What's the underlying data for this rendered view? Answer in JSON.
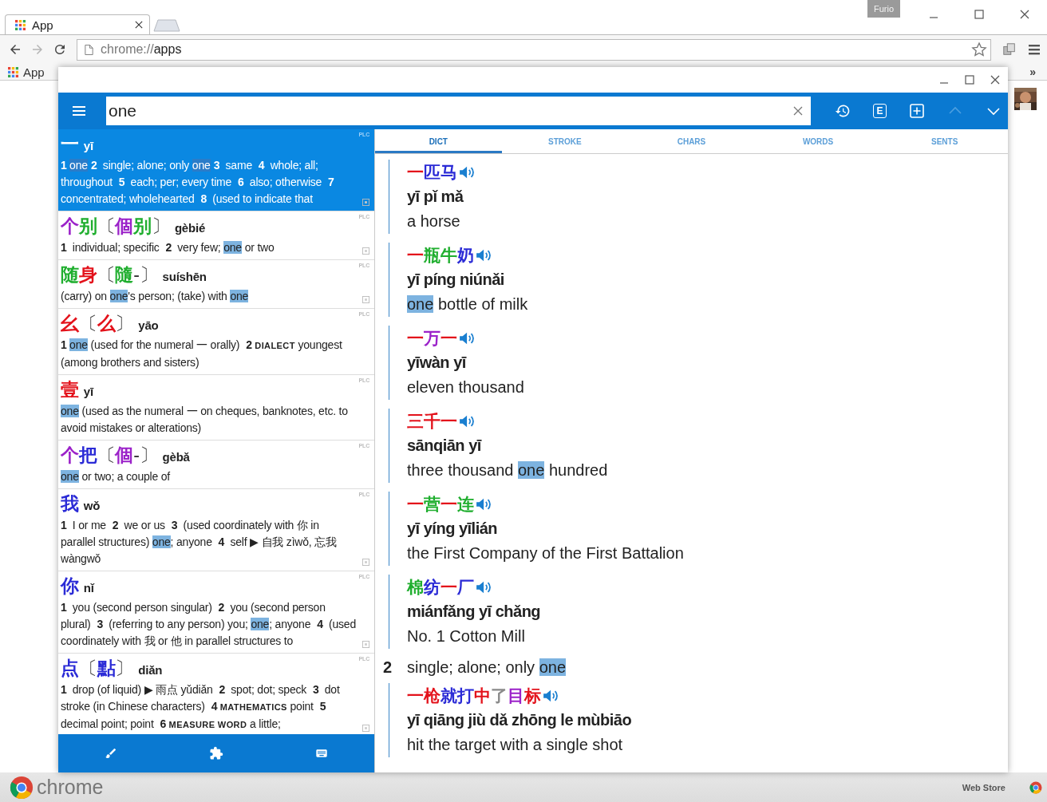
{
  "browser": {
    "tabs": [
      {
        "title": "App",
        "selected": true
      }
    ],
    "profile": "Furio",
    "nav": [
      {
        "kind": "back",
        "disabled": false
      },
      {
        "kind": "forward",
        "disabled": true
      },
      {
        "kind": "reload",
        "disabled": false
      }
    ],
    "address": {
      "scheme": "chrome://",
      "path": "apps"
    },
    "bookmarks": [
      {
        "label": "App"
      }
    ],
    "bookmarks_overflow": "»"
  },
  "app": {
    "search": {
      "value": "one"
    },
    "toolbar": [
      {
        "kind": "history",
        "disabled": false
      },
      {
        "kind": "letter",
        "label": "E",
        "disabled": false
      },
      {
        "kind": "add",
        "disabled": false
      },
      {
        "kind": "up",
        "disabled": true
      },
      {
        "kind": "down",
        "disabled": false
      }
    ],
    "results": [
      {
        "selected": true,
        "source": "PLC",
        "truncated": true,
        "headword": [
          {
            "text": "一",
            "color": "#ffffff"
          }
        ],
        "pinyin": "yī",
        "definition": [
          {
            "kind": "num",
            "text": "1"
          },
          {
            "kind": "hit",
            "text": "one"
          },
          {
            "kind": "num",
            "text": "2"
          },
          {
            "kind": "text",
            "text": " single; alone; only "
          },
          {
            "kind": "hit",
            "text": "one"
          },
          {
            "kind": "num",
            "text": "3"
          },
          {
            "kind": "text",
            "text": " same  "
          },
          {
            "kind": "num",
            "text": "4"
          },
          {
            "kind": "text",
            "text": " whole; all; throughout  "
          },
          {
            "kind": "num",
            "text": "5"
          },
          {
            "kind": "text",
            "text": " each; per; every time  "
          },
          {
            "kind": "num",
            "text": "6"
          },
          {
            "kind": "text",
            "text": " also; otherwise  "
          },
          {
            "kind": "num",
            "text": "7"
          },
          {
            "kind": "text",
            "text": " concentrated; wholehearted  "
          },
          {
            "kind": "num",
            "text": "8"
          },
          {
            "kind": "text",
            "text": " (used to indicate that"
          }
        ]
      },
      {
        "selected": false,
        "source": "PLC",
        "truncated": true,
        "headword": [
          {
            "text": "个",
            "color": "#9b22c9"
          },
          {
            "text": "别",
            "color": "#1fae2e"
          },
          {
            "kind": "bracket",
            "text": "〔"
          },
          {
            "text": "個",
            "color": "#9b22c9"
          },
          {
            "text": "别",
            "color": "#1fae2e"
          },
          {
            "kind": "bracket",
            "text": "〕"
          }
        ],
        "pinyin": "gèbié",
        "definition": [
          {
            "kind": "num",
            "text": "1"
          },
          {
            "kind": "text",
            "text": " individual; specific  "
          },
          {
            "kind": "num",
            "text": "2"
          },
          {
            "kind": "text",
            "text": " very few; "
          },
          {
            "kind": "hit",
            "text": "one"
          },
          {
            "kind": "text",
            "text": " or two"
          }
        ]
      },
      {
        "selected": false,
        "source": "PLC",
        "truncated": true,
        "headword": [
          {
            "text": "随",
            "color": "#1fae2e"
          },
          {
            "text": "身",
            "color": "#e3121b"
          },
          {
            "kind": "bracket",
            "text": "〔"
          },
          {
            "text": "隨",
            "color": "#1fae2e"
          },
          {
            "kind": "bracket",
            "text": "-"
          },
          {
            "kind": "bracket",
            "text": "〕"
          }
        ],
        "pinyin": "suíshēn",
        "definition": [
          {
            "kind": "text",
            "text": "(carry) on "
          },
          {
            "kind": "hit",
            "text": "one"
          },
          {
            "kind": "text",
            "text": "'s person; (take) with "
          },
          {
            "kind": "hit",
            "text": "one"
          }
        ]
      },
      {
        "selected": false,
        "source": "PLC",
        "truncated": false,
        "headword": [
          {
            "text": "幺",
            "color": "#e3121b"
          },
          {
            "kind": "bracket",
            "text": "〔"
          },
          {
            "text": "么",
            "color": "#e3121b"
          },
          {
            "kind": "bracket",
            "text": "〕"
          }
        ],
        "pinyin": "yāo",
        "definition": [
          {
            "kind": "num",
            "text": "1"
          },
          {
            "kind": "hit",
            "text": "one"
          },
          {
            "kind": "text",
            "text": " (used for the numeral 一 orally)  "
          },
          {
            "kind": "num",
            "text": "2"
          },
          {
            "kind": "label",
            "text": "DIALECT"
          },
          {
            "kind": "text",
            "text": " youngest (among brothers and sisters)"
          }
        ]
      },
      {
        "selected": false,
        "source": "PLC",
        "truncated": false,
        "headword": [
          {
            "text": "壹",
            "color": "#e3121b"
          }
        ],
        "pinyin": "yī",
        "definition": [
          {
            "kind": "hit",
            "text": "one"
          },
          {
            "kind": "text",
            "text": " (used as the numeral 一 on cheques, banknotes, etc. to avoid mistakes or alterations)"
          }
        ]
      },
      {
        "selected": false,
        "source": "PLC",
        "truncated": false,
        "headword": [
          {
            "text": "个",
            "color": "#9b22c9"
          },
          {
            "text": "把",
            "color": "#2b2bd6"
          },
          {
            "kind": "bracket",
            "text": "〔"
          },
          {
            "text": "個",
            "color": "#9b22c9"
          },
          {
            "kind": "bracket",
            "text": "-"
          },
          {
            "kind": "bracket",
            "text": "〕"
          }
        ],
        "pinyin": "gèbǎ",
        "definition": [
          {
            "kind": "hit",
            "text": "one"
          },
          {
            "kind": "text",
            "text": " or two; a couple of"
          }
        ]
      },
      {
        "selected": false,
        "source": "PLC",
        "truncated": true,
        "headword": [
          {
            "text": "我",
            "color": "#2b2bd6"
          }
        ],
        "pinyin": "wǒ",
        "definition": [
          {
            "kind": "num",
            "text": "1"
          },
          {
            "kind": "text",
            "text": " I or me  "
          },
          {
            "kind": "num",
            "text": "2"
          },
          {
            "kind": "text",
            "text": " we or us  "
          },
          {
            "kind": "num",
            "text": "3"
          },
          {
            "kind": "text",
            "text": " (used coordinately with 你 in parallel structures) "
          },
          {
            "kind": "hit",
            "text": "one"
          },
          {
            "kind": "text",
            "text": "; anyone  "
          },
          {
            "kind": "num",
            "text": "4"
          },
          {
            "kind": "text",
            "text": " self ▶ 自我 zìwǒ, 忘我 wàngwǒ"
          }
        ]
      },
      {
        "selected": false,
        "source": "PLC",
        "truncated": true,
        "headword": [
          {
            "text": "你",
            "color": "#2b2bd6"
          }
        ],
        "pinyin": "nǐ",
        "definition": [
          {
            "kind": "num",
            "text": "1"
          },
          {
            "kind": "text",
            "text": " you (second person singular)  "
          },
          {
            "kind": "num",
            "text": "2"
          },
          {
            "kind": "text",
            "text": " you (second person plural)  "
          },
          {
            "kind": "num",
            "text": "3"
          },
          {
            "kind": "text",
            "text": " (referring to any person) you; "
          },
          {
            "kind": "hit",
            "text": "one"
          },
          {
            "kind": "text",
            "text": "; anyone  "
          },
          {
            "kind": "num",
            "text": "4"
          },
          {
            "kind": "text",
            "text": " (used coordinately with 我 or 他 in parallel structures to"
          }
        ]
      },
      {
        "selected": false,
        "source": "PLC",
        "truncated": true,
        "headword": [
          {
            "text": "点",
            "color": "#2b2bd6"
          },
          {
            "kind": "bracket",
            "text": "〔"
          },
          {
            "text": "點",
            "color": "#2b2bd6"
          },
          {
            "kind": "bracket",
            "text": "〕"
          }
        ],
        "pinyin": "diǎn",
        "definition": [
          {
            "kind": "num",
            "text": "1"
          },
          {
            "kind": "text",
            "text": " drop (of liquid) ▶ 雨点 yǔdiǎn  "
          },
          {
            "kind": "num",
            "text": "2"
          },
          {
            "kind": "text",
            "text": " spot; dot; speck  "
          },
          {
            "kind": "num",
            "text": "3"
          },
          {
            "kind": "text",
            "text": " dot stroke (in Chinese characters)  "
          },
          {
            "kind": "num",
            "text": "4"
          },
          {
            "kind": "label",
            "text": "MATHEMATICS"
          },
          {
            "kind": "text",
            "text": " point  "
          },
          {
            "kind": "num",
            "text": "5"
          },
          {
            "kind": "text",
            "text": " decimal point; point  "
          },
          {
            "kind": "num",
            "text": "6"
          },
          {
            "kind": "label",
            "text": "MEASURE WORD"
          },
          {
            "kind": "text",
            "text": " a little;"
          }
        ]
      }
    ],
    "tools": [
      {
        "kind": "brush"
      },
      {
        "kind": "puzzle"
      },
      {
        "kind": "keyboard"
      }
    ],
    "tabs": [
      {
        "label": "DICT",
        "selected": true
      },
      {
        "label": "STROKE",
        "selected": false
      },
      {
        "label": "CHARS",
        "selected": false
      },
      {
        "label": "WORDS",
        "selected": false
      },
      {
        "label": "SENTS",
        "selected": false
      }
    ],
    "detail": [
      {
        "kind": "example",
        "hanzi": [
          {
            "text": "一",
            "color": "#e3121b"
          },
          {
            "text": "匹",
            "color": "#2b2bd6"
          },
          {
            "text": "马",
            "color": "#2b2bd6"
          }
        ],
        "pinyin": "yī pǐ mǎ",
        "meaning": [
          {
            "kind": "text",
            "text": "a horse"
          }
        ]
      },
      {
        "kind": "example",
        "hanzi": [
          {
            "text": "一",
            "color": "#e3121b"
          },
          {
            "text": "瓶",
            "color": "#1fae2e"
          },
          {
            "text": "牛",
            "color": "#1fae2e"
          },
          {
            "text": "奶",
            "color": "#2b2bd6"
          }
        ],
        "pinyin": "yī píng niúnǎi",
        "meaning": [
          {
            "kind": "hit",
            "text": "one"
          },
          {
            "kind": "text",
            "text": " bottle of milk"
          }
        ]
      },
      {
        "kind": "example",
        "hanzi": [
          {
            "text": "一",
            "color": "#e3121b"
          },
          {
            "text": "万",
            "color": "#9b22c9"
          },
          {
            "text": "一",
            "color": "#e3121b"
          }
        ],
        "pinyin": "yīwàn yī",
        "meaning": [
          {
            "kind": "text",
            "text": "eleven thousand"
          }
        ]
      },
      {
        "kind": "example",
        "hanzi": [
          {
            "text": "三",
            "color": "#e3121b"
          },
          {
            "text": "千",
            "color": "#e3121b"
          },
          {
            "text": "一",
            "color": "#e3121b"
          }
        ],
        "pinyin": "sānqiān yī",
        "meaning": [
          {
            "kind": "text",
            "text": "three thousand "
          },
          {
            "kind": "hit",
            "text": "one"
          },
          {
            "kind": "text",
            "text": " hundred"
          }
        ]
      },
      {
        "kind": "example",
        "hanzi": [
          {
            "text": "一",
            "color": "#e3121b"
          },
          {
            "text": "营",
            "color": "#1fae2e"
          },
          {
            "text": "一",
            "color": "#e3121b"
          },
          {
            "text": "连",
            "color": "#1fae2e"
          }
        ],
        "pinyin": "yī yíng yīlián",
        "meaning": [
          {
            "kind": "text",
            "text": "the First Company of the First Battalion"
          }
        ]
      },
      {
        "kind": "example",
        "hanzi": [
          {
            "text": "棉",
            "color": "#1fae2e"
          },
          {
            "text": "纺",
            "color": "#2b2bd6"
          },
          {
            "text": "一",
            "color": "#e3121b"
          },
          {
            "text": "厂",
            "color": "#2b2bd6"
          }
        ],
        "pinyin": "miánfǎng yī chǎng",
        "meaning": [
          {
            "kind": "text",
            "text": "No. 1 Cotton Mill"
          }
        ]
      },
      {
        "kind": "sense",
        "number": "2",
        "meaning": [
          {
            "kind": "text",
            "text": "single; alone; only "
          },
          {
            "kind": "hit",
            "text": "one"
          }
        ]
      },
      {
        "kind": "example",
        "hanzi": [
          {
            "text": "一",
            "color": "#e3121b"
          },
          {
            "text": "枪",
            "color": "#e3121b"
          },
          {
            "text": "就",
            "color": "#2b2bd6"
          },
          {
            "text": "打",
            "color": "#2b2bd6"
          },
          {
            "text": "中",
            "color": "#e3121b"
          },
          {
            "text": "了",
            "color": "#8a8a8a"
          },
          {
            "text": "目",
            "color": "#9b22c9"
          },
          {
            "text": "标",
            "color": "#e3121b"
          }
        ],
        "pinyin": "yī qiāng jiù dǎ zhōng le mùbiāo",
        "meaning": [
          {
            "kind": "text",
            "text": "hit the target with a single shot"
          }
        ]
      }
    ]
  },
  "footer": {
    "brand": "chrome",
    "store": "Web Store"
  }
}
